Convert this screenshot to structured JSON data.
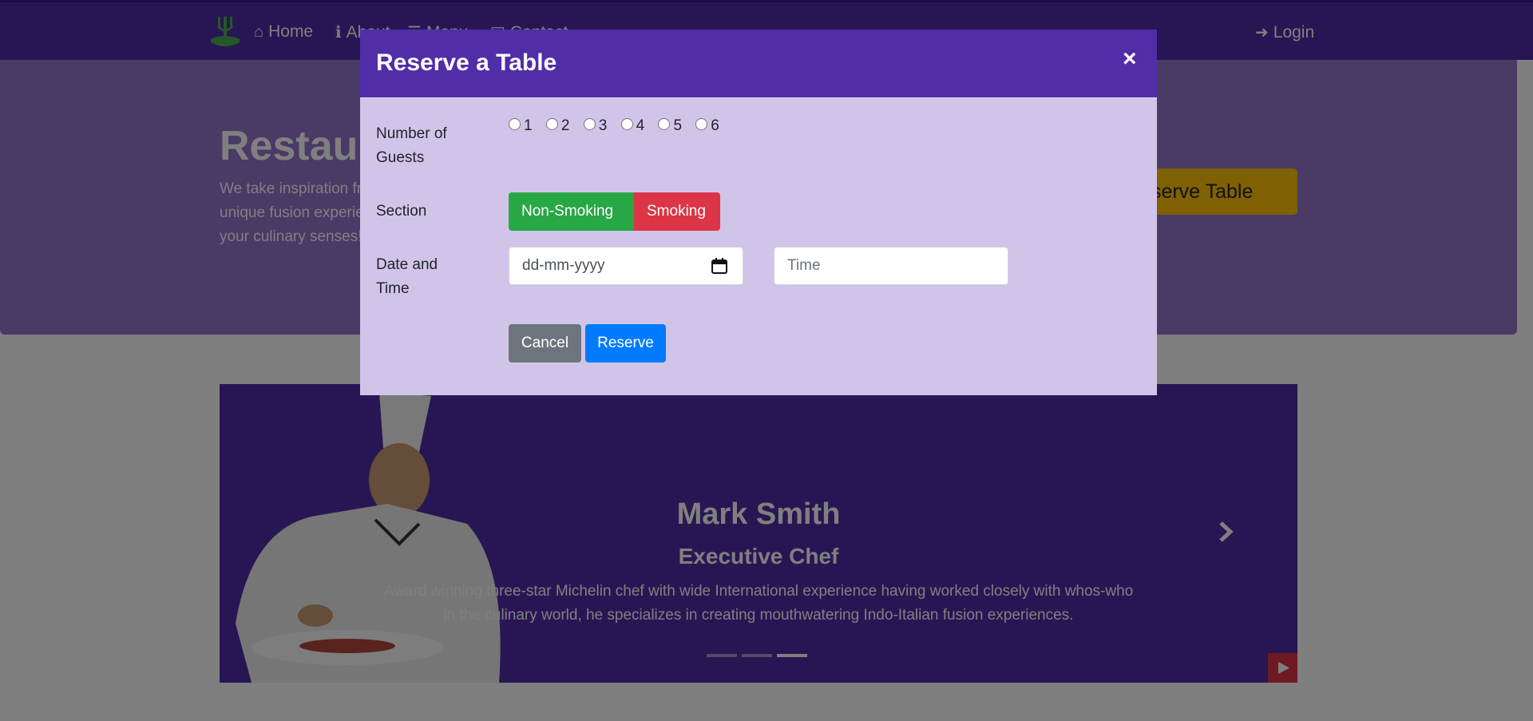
{
  "navbar": {
    "items": [
      {
        "label": "Home",
        "icon": "home-icon"
      },
      {
        "label": "About",
        "icon": "info-icon"
      },
      {
        "label": "Menu",
        "icon": "list-icon"
      },
      {
        "label": "Contact",
        "icon": "address-card-icon"
      }
    ],
    "login_label": "Login",
    "login_icon": "sign-in-icon",
    "background": "#512DA8"
  },
  "jumbotron": {
    "title": "Restaurant",
    "text": "We take inspiration from the World's best cuisines, and create a unique fusion experience. Our lipsmacking creations will tickle your culinary senses!",
    "reserve_button": "Reserve Table",
    "background": "#9575CD"
  },
  "carousel": {
    "name": "Mark Smith",
    "role": "Executive Chef",
    "description": "Award winning three-star Michelin chef with wide International experience having worked closely with whos-who in the culinary world, he specializes in creating mouthwatering Indo-Italian fusion experiences.",
    "indicators": 3,
    "active_indicator": 3
  },
  "modal": {
    "title": "Reserve a Table",
    "close_label": "×",
    "guests_label": "Number of Guests",
    "guest_options": [
      "1",
      "2",
      "3",
      "4",
      "5",
      "6"
    ],
    "section_label": "Section",
    "section_options": [
      "Non-Smoking",
      "Smoking"
    ],
    "datetime_label": "Date and Time",
    "date_placeholder": "dd-mm-yyyy",
    "time_placeholder": "Time",
    "cancel_label": "Cancel",
    "reserve_label": "Reserve",
    "header_color": "#512DA8",
    "body_color": "#D1C4E9"
  }
}
